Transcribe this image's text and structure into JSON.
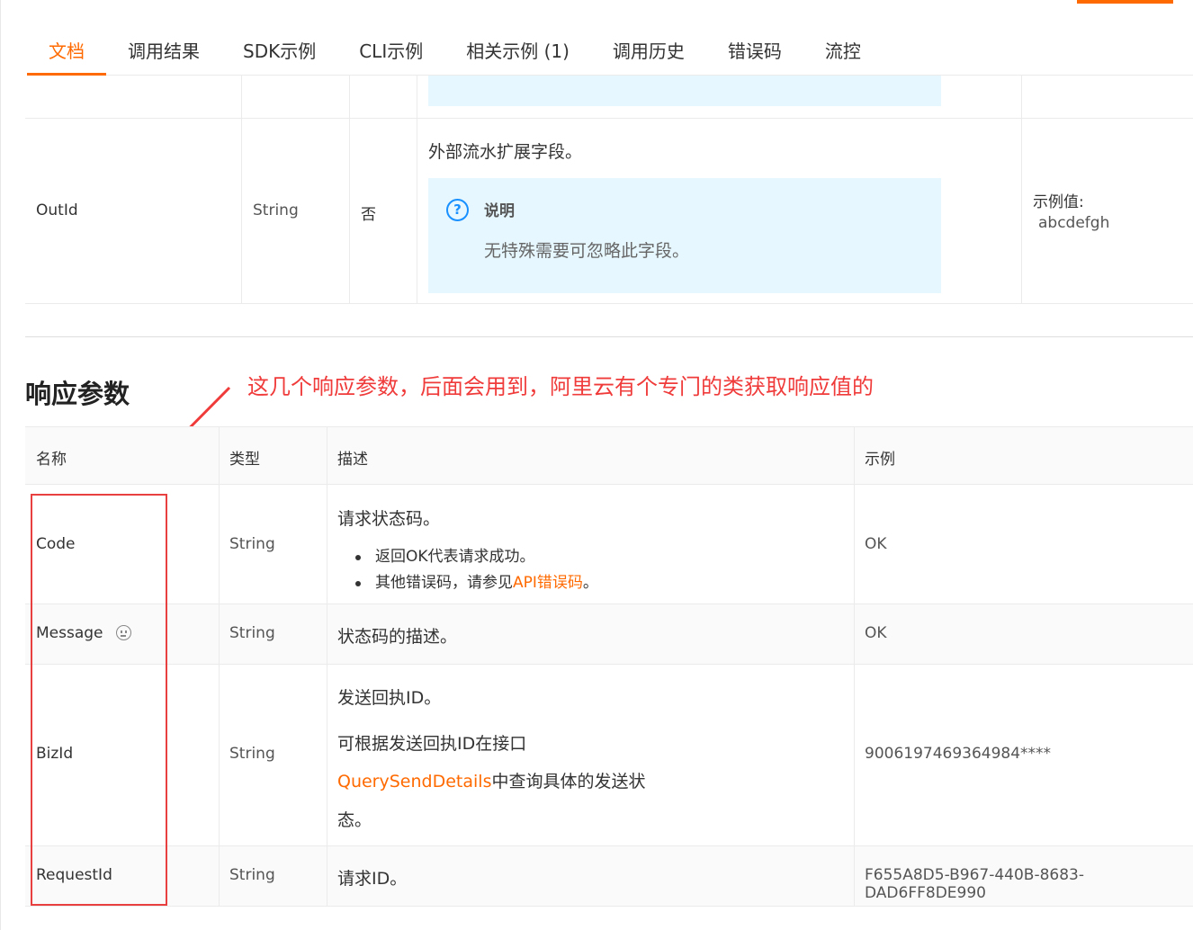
{
  "tabs": [
    {
      "label": "文档",
      "active": true
    },
    {
      "label": "调用结果",
      "active": false
    },
    {
      "label": "SDK示例",
      "active": false
    },
    {
      "label": "CLI示例",
      "active": false
    },
    {
      "label": "相关示例 (1)",
      "active": false
    },
    {
      "label": "调用历史",
      "active": false
    },
    {
      "label": "错误码",
      "active": false
    },
    {
      "label": "流控",
      "active": false
    }
  ],
  "request_params": {
    "outid": {
      "name": "OutId",
      "type": "String",
      "required": "否",
      "description": "外部流水扩展字段。",
      "note_title": "说明",
      "note_text": "无特殊需要可忽略此字段。",
      "example_label": "示例值:",
      "example_value": "abcdefgh"
    }
  },
  "response": {
    "title": "响应参数",
    "annotation": "这几个响应参数，后面会用到，阿里云有个专门的类获取响应值的",
    "headers": {
      "name": "名称",
      "type": "类型",
      "desc": "描述",
      "example": "示例"
    },
    "rows": {
      "code": {
        "name": "Code",
        "type": "String",
        "desc": "请求状态码。",
        "bullet1": "返回OK代表请求成功。",
        "bullet2_prefix": "其他错误码，请参见",
        "bullet2_link": "API错误码",
        "bullet2_suffix": "。",
        "example": "OK"
      },
      "message": {
        "name": "Message",
        "type": "String",
        "desc": "状态码的描述。",
        "example": "OK"
      },
      "bizid": {
        "name": "BizId",
        "type": "String",
        "desc1": "发送回执ID。",
        "desc2": "可根据发送回执ID在接口",
        "link": "QuerySendDetails",
        "desc3": "中查询具体的发送状",
        "desc4": "态。",
        "example": "9006197469364984****"
      },
      "requestid": {
        "name": "RequestId",
        "type": "String",
        "desc": "请求ID。",
        "example": "F655A8D5-B967-440B-8683-DAD6FF8DE990"
      }
    }
  },
  "colors": {
    "accent": "#ff6a00",
    "annotation_red": "#f03b3b",
    "note_bg": "#e6f7ff",
    "note_icon": "#1890ff"
  }
}
